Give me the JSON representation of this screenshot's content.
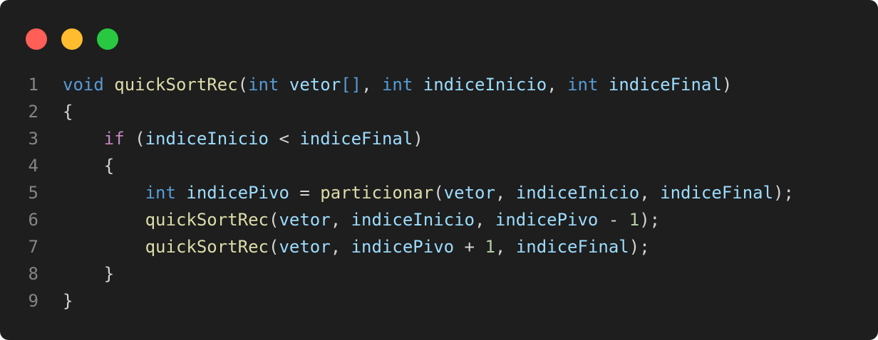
{
  "window": {
    "buttons": [
      {
        "name": "close",
        "color": "#ff5f57"
      },
      {
        "name": "minimize",
        "color": "#febc2e"
      },
      {
        "name": "maximize",
        "color": "#28c840"
      }
    ]
  },
  "theme": {
    "background": "#1e1e1e",
    "keyword": "#569cd6",
    "function": "#dcdcaa",
    "variable": "#9cdcfe",
    "control": "#c586c0",
    "number": "#b5cea8",
    "punctuation": "#d4d4d4",
    "line_number": "#858585"
  },
  "code": {
    "language": "c",
    "lines": [
      {
        "number": "1",
        "tokens": [
          {
            "t": "void",
            "k": "kw"
          },
          {
            "t": " ",
            "k": "ws"
          },
          {
            "t": "quickSortRec",
            "k": "fn"
          },
          {
            "t": "(",
            "k": "punc"
          },
          {
            "t": "int",
            "k": "kw"
          },
          {
            "t": " ",
            "k": "ws"
          },
          {
            "t": "vetor",
            "k": "var"
          },
          {
            "t": "[]",
            "k": "kw"
          },
          {
            "t": ", ",
            "k": "punc"
          },
          {
            "t": "int",
            "k": "kw"
          },
          {
            "t": " ",
            "k": "ws"
          },
          {
            "t": "indiceInicio",
            "k": "var"
          },
          {
            "t": ", ",
            "k": "punc"
          },
          {
            "t": "int",
            "k": "kw"
          },
          {
            "t": " ",
            "k": "ws"
          },
          {
            "t": "indiceFinal",
            "k": "var"
          },
          {
            "t": ")",
            "k": "punc"
          }
        ]
      },
      {
        "number": "2",
        "tokens": [
          {
            "t": "{",
            "k": "punc"
          }
        ]
      },
      {
        "number": "3",
        "tokens": [
          {
            "t": "    ",
            "k": "ws"
          },
          {
            "t": "if",
            "k": "ctrl"
          },
          {
            "t": " (",
            "k": "punc"
          },
          {
            "t": "indiceInicio",
            "k": "var"
          },
          {
            "t": " < ",
            "k": "punc"
          },
          {
            "t": "indiceFinal",
            "k": "var"
          },
          {
            "t": ")",
            "k": "punc"
          }
        ]
      },
      {
        "number": "4",
        "tokens": [
          {
            "t": "    ",
            "k": "ws"
          },
          {
            "t": "{",
            "k": "punc"
          }
        ]
      },
      {
        "number": "5",
        "tokens": [
          {
            "t": "        ",
            "k": "ws"
          },
          {
            "t": "int",
            "k": "kw"
          },
          {
            "t": " ",
            "k": "ws"
          },
          {
            "t": "indicePivo",
            "k": "var"
          },
          {
            "t": " = ",
            "k": "punc"
          },
          {
            "t": "particionar",
            "k": "fn"
          },
          {
            "t": "(",
            "k": "punc"
          },
          {
            "t": "vetor",
            "k": "var"
          },
          {
            "t": ", ",
            "k": "punc"
          },
          {
            "t": "indiceInicio",
            "k": "var"
          },
          {
            "t": ", ",
            "k": "punc"
          },
          {
            "t": "indiceFinal",
            "k": "var"
          },
          {
            "t": ");",
            "k": "punc"
          }
        ]
      },
      {
        "number": "6",
        "tokens": [
          {
            "t": "        ",
            "k": "ws"
          },
          {
            "t": "quickSortRec",
            "k": "fn"
          },
          {
            "t": "(",
            "k": "punc"
          },
          {
            "t": "vetor",
            "k": "var"
          },
          {
            "t": ", ",
            "k": "punc"
          },
          {
            "t": "indiceInicio",
            "k": "var"
          },
          {
            "t": ", ",
            "k": "punc"
          },
          {
            "t": "indicePivo",
            "k": "var"
          },
          {
            "t": " - ",
            "k": "punc"
          },
          {
            "t": "1",
            "k": "num"
          },
          {
            "t": ");",
            "k": "punc"
          }
        ]
      },
      {
        "number": "7",
        "tokens": [
          {
            "t": "        ",
            "k": "ws"
          },
          {
            "t": "quickSortRec",
            "k": "fn"
          },
          {
            "t": "(",
            "k": "punc"
          },
          {
            "t": "vetor",
            "k": "var"
          },
          {
            "t": ", ",
            "k": "punc"
          },
          {
            "t": "indicePivo",
            "k": "var"
          },
          {
            "t": " + ",
            "k": "punc"
          },
          {
            "t": "1",
            "k": "num"
          },
          {
            "t": ", ",
            "k": "punc"
          },
          {
            "t": "indiceFinal",
            "k": "var"
          },
          {
            "t": ");",
            "k": "punc"
          }
        ]
      },
      {
        "number": "8",
        "tokens": [
          {
            "t": "    ",
            "k": "ws"
          },
          {
            "t": "}",
            "k": "punc"
          }
        ]
      },
      {
        "number": "9",
        "tokens": [
          {
            "t": "}",
            "k": "punc"
          }
        ]
      }
    ]
  }
}
